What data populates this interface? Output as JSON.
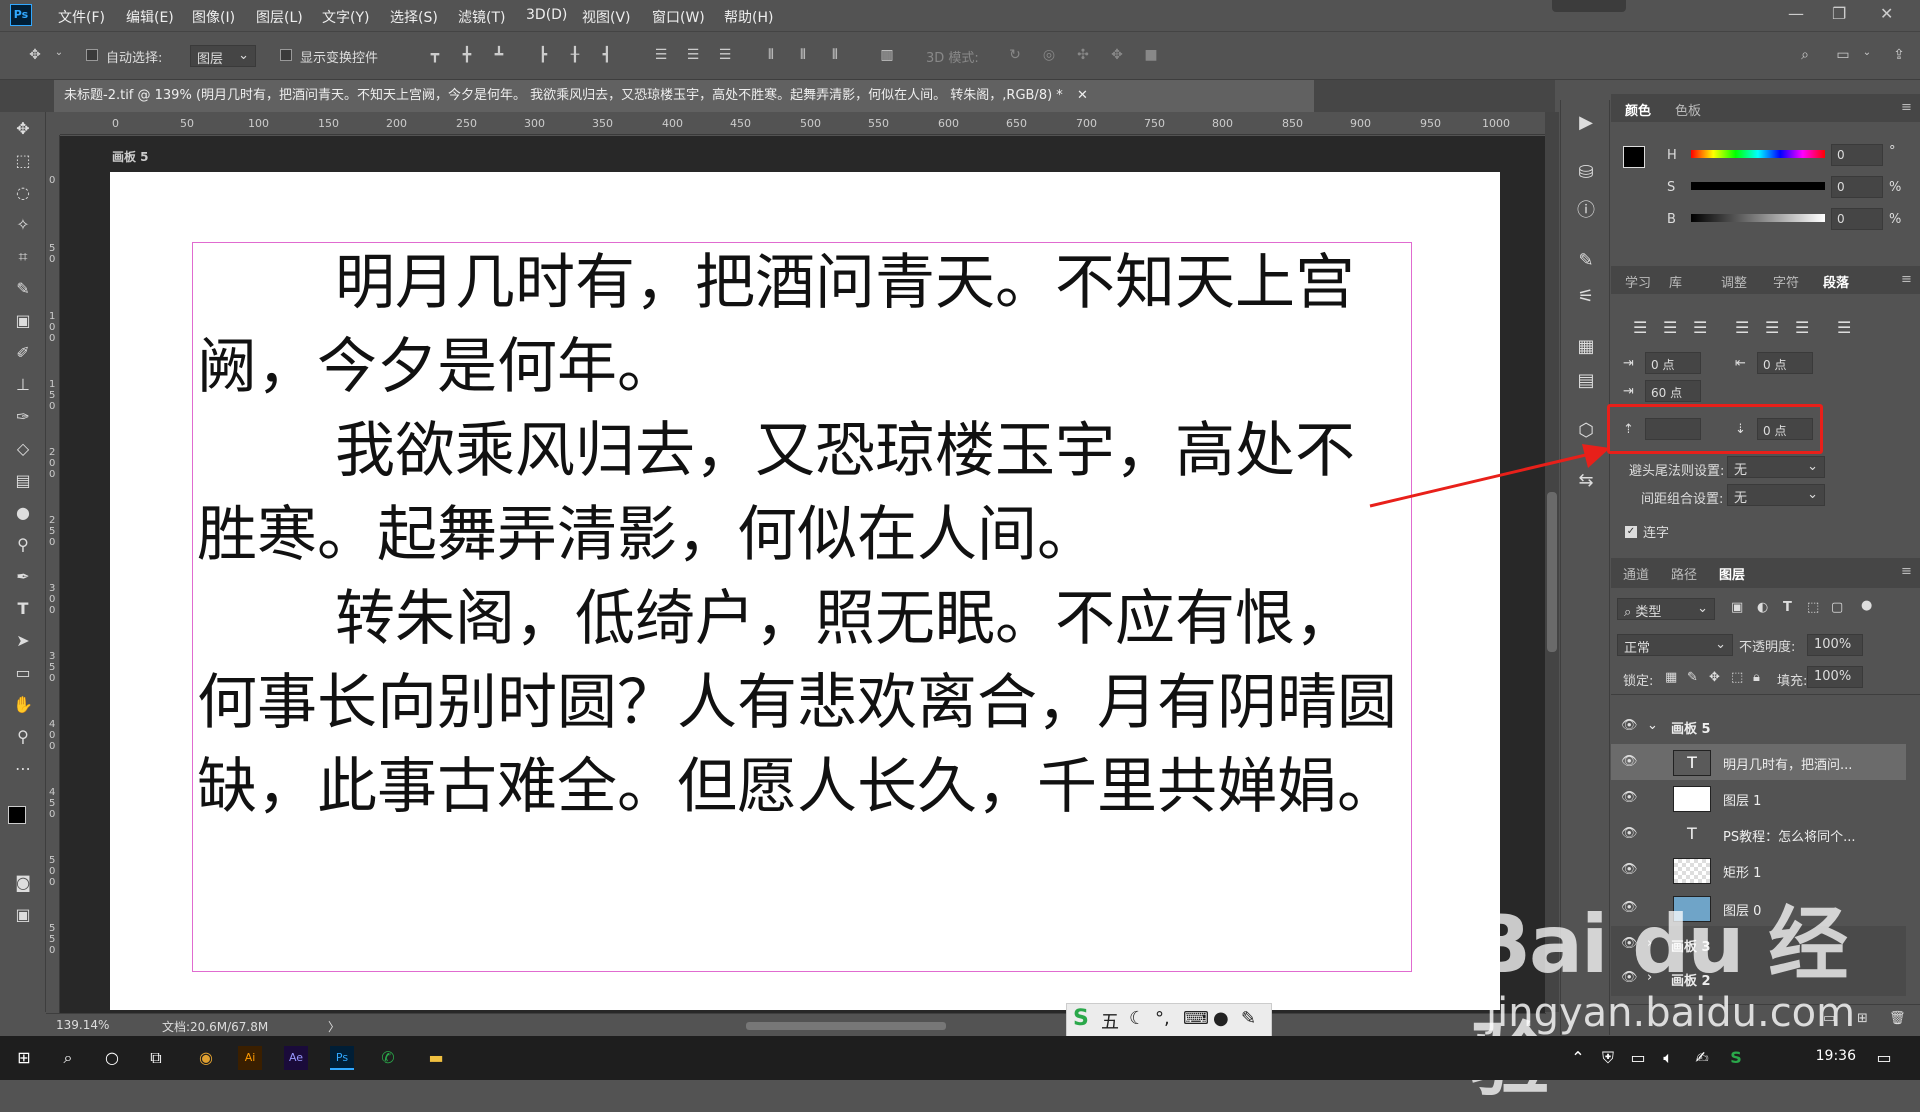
{
  "app": {
    "logo": "Ps"
  },
  "menu": [
    "文件(F)",
    "编辑(E)",
    "图像(I)",
    "图层(L)",
    "文字(Y)",
    "选择(S)",
    "滤镜(T)",
    "3D(D)",
    "视图(V)",
    "窗口(W)",
    "帮助(H)"
  ],
  "options": {
    "auto_select_label": "自动选择:",
    "auto_select_target": "图层",
    "show_transform_label": "显示变换控件",
    "mode_3d_label": "3D 模式:"
  },
  "document": {
    "tab_title": "未标题-2.tif @ 139% (明月几时有，把酒问青天。不知天上宫阙，今夕是何年。 我欲乘风归去，又恐琼楼玉宇，高处不胜寒。起舞弄清影，何似在人间。 转朱阁，,RGB/8) *",
    "artboard_name": "画板 5",
    "ruler_h": [
      "0",
      "50",
      "100",
      "150",
      "200",
      "250",
      "300",
      "350",
      "400",
      "450",
      "500",
      "550",
      "600",
      "650",
      "700",
      "750",
      "800",
      "850",
      "900",
      "950",
      "1000"
    ],
    "ruler_v": [
      "0",
      "5 0",
      "1 0 0",
      "1 5 0",
      "2 0 0",
      "2 5 0",
      "3 0 0",
      "3 5 0",
      "4 0 0",
      "4 5 0",
      "5 0 0",
      "5 5 0"
    ],
    "paragraphs": [
      "明月几时有，把酒问青天。不知天上宫阙，今夕是何年。",
      "我欲乘风归去，又恐琼楼玉宇，高处不胜寒。起舞弄清影，何似在人间。",
      "转朱阁，低绮户，照无眠。不应有恨，何事长向别时圆？人有悲欢离合，月有阴晴圆缺，此事古难全。但愿人长久，千里共婵娟。"
    ]
  },
  "status": {
    "zoom": "139.14%",
    "doc_size": "文档:20.6M/67.8M"
  },
  "color_panel": {
    "tabs": [
      "颜色",
      "色板"
    ],
    "active_tab": "颜色",
    "h_label": "H",
    "s_label": "S",
    "b_label": "B",
    "h_value": "0",
    "s_value": "0",
    "b_value": "0",
    "h_unit": "°",
    "s_unit": "%",
    "b_unit": "%"
  },
  "paragraph_panel": {
    "tabs": [
      "学习",
      "库",
      "调整",
      "字符",
      "段落"
    ],
    "active_tab": "段落",
    "indent_left": "0 点",
    "indent_right": "0 点",
    "first_line_indent": "60 点",
    "space_before": "",
    "space_after": "0 点",
    "kinsoku_label": "避头尾法则设置:",
    "kinsoku_value": "无",
    "mojikumi_label": "间距组合设置:",
    "mojikumi_value": "无",
    "hyphenate_label": "连字"
  },
  "layers_panel": {
    "tabs": [
      "通道",
      "路径",
      "图层"
    ],
    "active_tab": "图层",
    "filter_label": "类型",
    "blend_mode": "正常",
    "opacity_label": "不透明度:",
    "opacity_value": "100%",
    "lock_label": "锁定:",
    "fill_label": "填充:",
    "fill_value": "100%",
    "layers": [
      {
        "name": "画板 5",
        "kind": "group"
      },
      {
        "name": "明月几时有，把酒问...",
        "kind": "text"
      },
      {
        "name": "图层 1",
        "kind": "fill"
      },
      {
        "name": "PS教程：怎么将同个...",
        "kind": "text"
      },
      {
        "name": "矩形 1",
        "kind": "shape"
      },
      {
        "name": "图层 0",
        "kind": "image"
      },
      {
        "name": "画板 3",
        "kind": "group"
      },
      {
        "name": "画板 2",
        "kind": "group"
      }
    ]
  },
  "ime": {
    "mode": "五"
  },
  "taskbar": {
    "time": "19:36"
  },
  "watermark": {
    "brand": "Bai du 经验",
    "url": "jingyan.baidu.com"
  },
  "colors": {
    "accent_red": "#e8201a",
    "text_box_border": "#e06bd0",
    "ps_blue": "#31a8ff"
  }
}
